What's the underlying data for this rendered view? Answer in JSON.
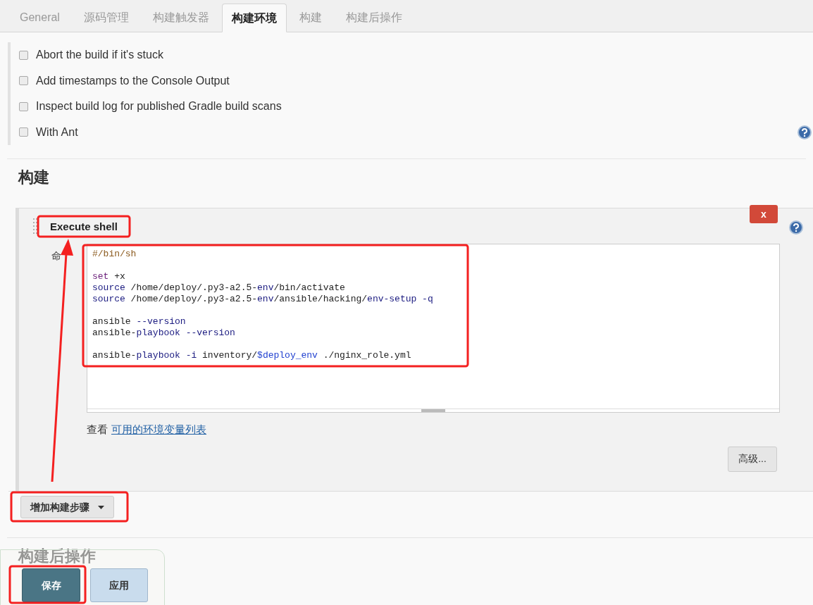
{
  "tabs": [
    {
      "label": "General",
      "selected": false
    },
    {
      "label": "源码管理",
      "selected": false
    },
    {
      "label": "构建触发器",
      "selected": false
    },
    {
      "label": "构建环境",
      "selected": true
    },
    {
      "label": "构建",
      "selected": false
    },
    {
      "label": "构建后操作",
      "selected": false
    }
  ],
  "build_environment": {
    "options": [
      {
        "label": "Abort the build if it's stuck",
        "checked": false,
        "help": false
      },
      {
        "label": "Add timestamps to the Console Output",
        "checked": false,
        "help": false
      },
      {
        "label": "Inspect build log for published Gradle build scans",
        "checked": false,
        "help": false
      },
      {
        "label": "With Ant",
        "checked": false,
        "help": true
      }
    ]
  },
  "build": {
    "heading": "构建",
    "step": {
      "title": "Execute shell",
      "delete_button": "x",
      "command_label": "命",
      "command": [
        {
          "blank_before": false,
          "tokens": [
            {
              "kind": "comment",
              "text": "#/bin/sh"
            }
          ]
        },
        {
          "blank_before": true,
          "tokens": [
            {
              "kind": "keyword",
              "text": "set"
            },
            {
              "kind": "plain",
              "text": " +x"
            }
          ]
        },
        {
          "blank_before": false,
          "tokens": [
            {
              "kind": "name",
              "text": "source"
            },
            {
              "kind": "plain",
              "text": " /home/deploy/.py3-a2.5-"
            },
            {
              "kind": "name",
              "text": "env"
            },
            {
              "kind": "plain",
              "text": "/bin/activate"
            }
          ]
        },
        {
          "blank_before": false,
          "tokens": [
            {
              "kind": "name",
              "text": "source"
            },
            {
              "kind": "plain",
              "text": " /home/deploy/.py3-a2.5-"
            },
            {
              "kind": "name",
              "text": "env"
            },
            {
              "kind": "plain",
              "text": "/ansible/hacking/"
            },
            {
              "kind": "name",
              "text": "env-setup -q"
            }
          ]
        },
        {
          "blank_before": true,
          "tokens": [
            {
              "kind": "plain",
              "text": "ansible "
            },
            {
              "kind": "name",
              "text": "--version"
            }
          ]
        },
        {
          "blank_before": false,
          "tokens": [
            {
              "kind": "plain",
              "text": "ansible-"
            },
            {
              "kind": "name",
              "text": "playbook --version"
            }
          ]
        },
        {
          "blank_before": true,
          "tokens": [
            {
              "kind": "plain",
              "text": "ansible-"
            },
            {
              "kind": "name",
              "text": "playbook -i"
            },
            {
              "kind": "plain",
              "text": " inventory/"
            },
            {
              "kind": "variable",
              "text": "$deploy_env"
            },
            {
              "kind": "plain",
              "text": " ./nginx_role.yml"
            }
          ]
        }
      ],
      "see_label": "查看",
      "env_link": "可用的环境变量列表",
      "advanced_button": "高级..."
    },
    "add_step_button": "增加构建步骤"
  },
  "post_build": {
    "heading": "构建后操作"
  },
  "footer": {
    "save_button": "保存",
    "apply_button": "应用"
  }
}
